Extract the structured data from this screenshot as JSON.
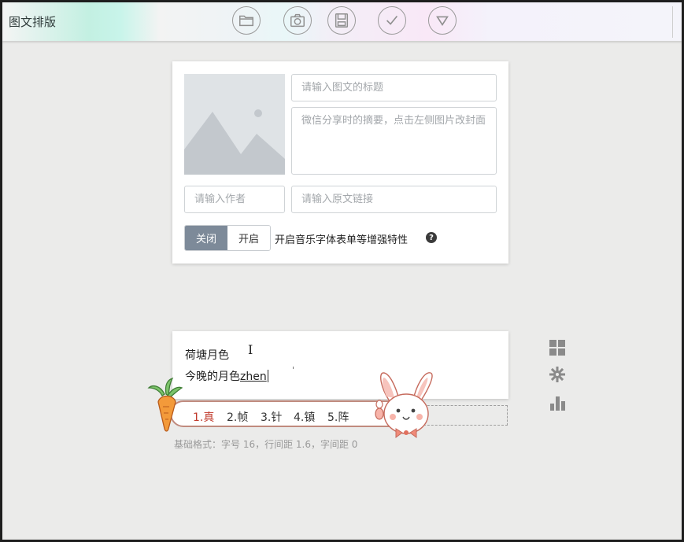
{
  "app": {
    "title": "图文排版"
  },
  "toolbar": {
    "buttons": [
      {
        "icon": "folder-icon"
      },
      {
        "icon": "camera-icon"
      },
      {
        "icon": "save-icon"
      },
      {
        "icon": "check-icon"
      },
      {
        "icon": "dropdown-triangle-icon"
      }
    ]
  },
  "form": {
    "title_placeholder": "请输入图文的标题",
    "summary_placeholder": "微信分享时的摘要，点击左侧图片改封面",
    "author_placeholder": "请输入作者",
    "link_placeholder": "请输入原文链接",
    "toggle_off_label": "关闭",
    "toggle_on_label": "开启",
    "toggle_state": "关闭",
    "feature_label": "开启音乐字体表单等增强特性",
    "help_symbol": "?"
  },
  "editor": {
    "line1": "荷塘月色",
    "line2_committed": "今晚的月色",
    "line2_composing": "zhen"
  },
  "ime": {
    "candidates": [
      "1.真",
      "2.帧",
      "3.针",
      "4.镇",
      "5.阵"
    ],
    "selected_index": 0
  },
  "side_tools": [
    {
      "icon": "grid-icon"
    },
    {
      "icon": "gear-icon"
    },
    {
      "icon": "bar-chart-icon"
    }
  ],
  "status": {
    "base_format": "基础格式：字号 16，行间距 1.6，字间距 0"
  },
  "colors": {
    "toggle_active": "#7d8a99",
    "candidate_selected": "#c0392b",
    "candidate_border": "#c08a7e"
  }
}
